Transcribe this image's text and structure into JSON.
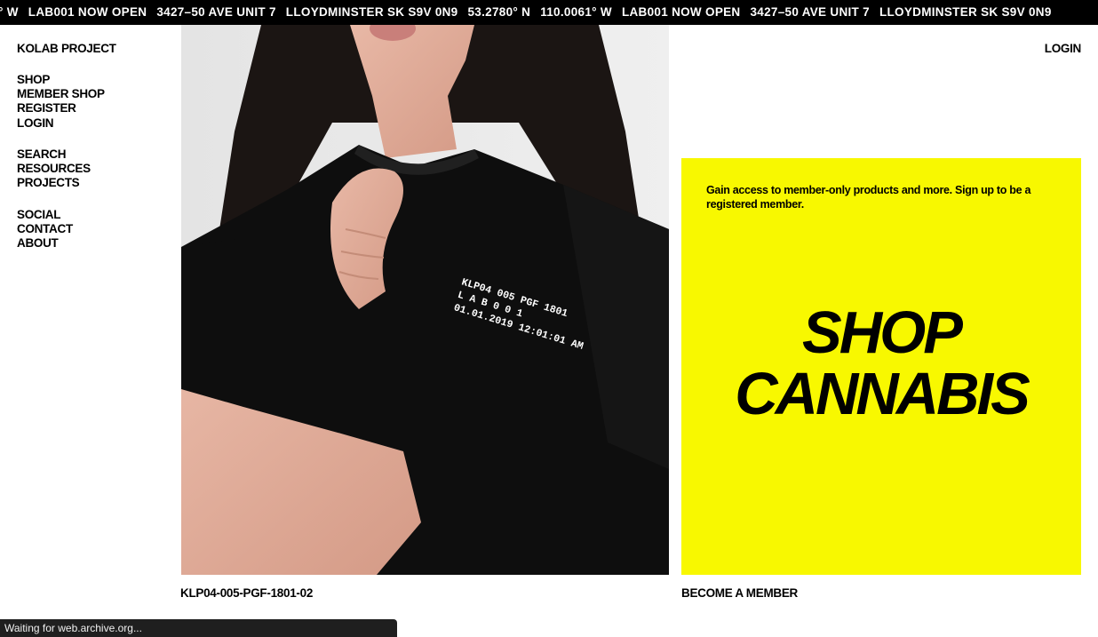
{
  "ticker": {
    "items": [
      "° W",
      "LAB001 NOW OPEN",
      "3427–50 AVE UNIT 7",
      "LLOYDMINSTER SK S9V 0N9",
      "53.2780° N",
      "110.0061° W",
      "LAB001 NOW OPEN",
      "3427–50 AVE UNIT 7",
      "LLOYDMINSTER SK S9V 0N9"
    ]
  },
  "brand": "KOLAB PROJECT",
  "nav": {
    "group1": [
      "SHOP",
      "MEMBER SHOP",
      "REGISTER",
      "LOGIN"
    ],
    "group2": [
      "SEARCH",
      "RESOURCES",
      "PROJECTS"
    ],
    "group3": [
      "SOCIAL",
      "CONTACT",
      "ABOUT"
    ]
  },
  "header": {
    "login": "LOGIN"
  },
  "product": {
    "shirt_print": [
      "KLP04  005  PGF  1801",
      "L    A    B    0    0    1",
      "01.01.2019  12:01:01 AM"
    ],
    "caption": "KLP04-005-PGF-1801-02"
  },
  "promo": {
    "text": "Gain access to member-only products and more. Sign up to be a registered member.",
    "headline_line1": "SHOP",
    "headline_line2": "CANNABIS",
    "cta": "BECOME A MEMBER",
    "color": "#f8f800"
  },
  "browser": {
    "status": "Waiting for web.archive.org..."
  }
}
